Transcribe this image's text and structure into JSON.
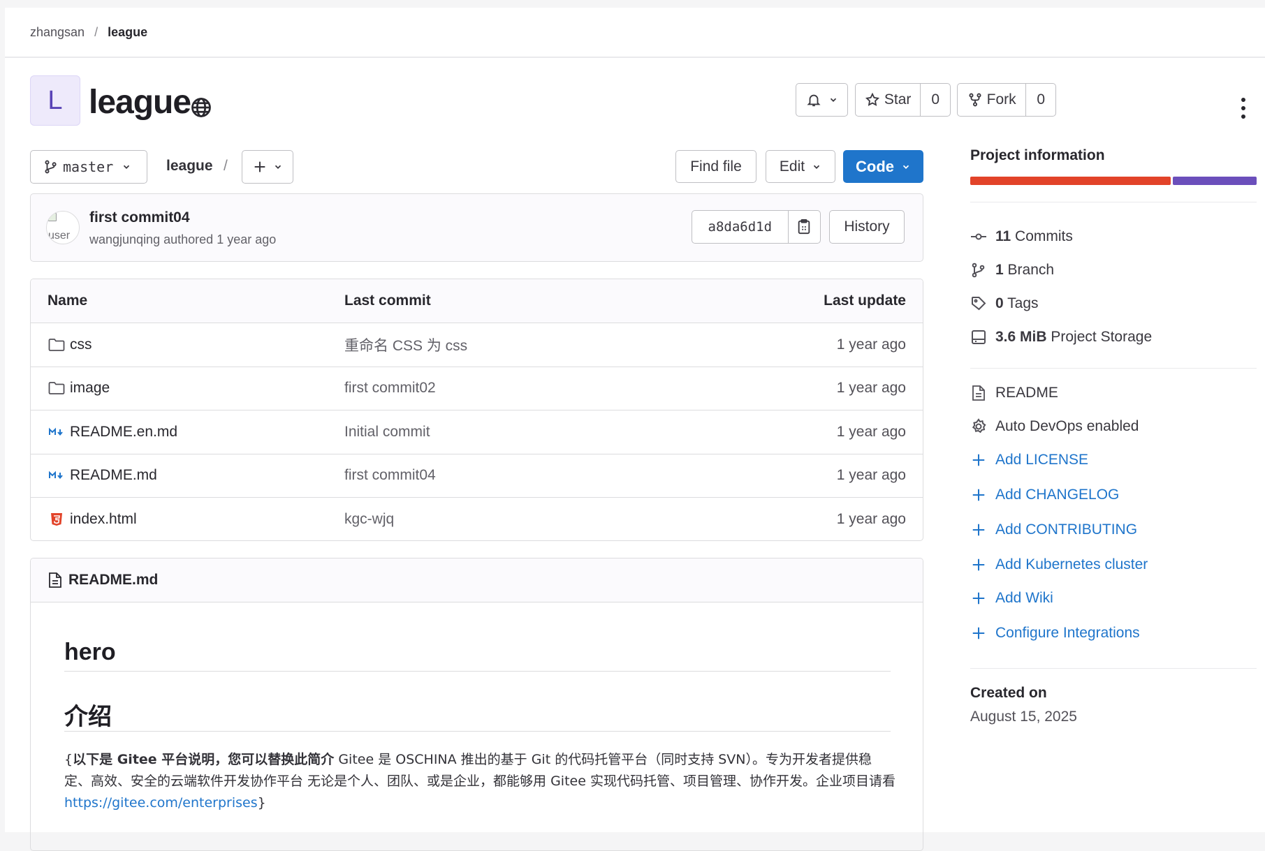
{
  "breadcrumb": {
    "owner": "zhangsan",
    "separator": "/",
    "project": "league"
  },
  "header": {
    "avatar_letter": "L",
    "title": "league",
    "star_label": "Star",
    "star_count": "0",
    "fork_label": "Fork",
    "fork_count": "0"
  },
  "repo_nav": {
    "branch": "master",
    "path_root": "league",
    "path_sep": "/",
    "find_file": "Find file",
    "edit": "Edit",
    "code": "Code"
  },
  "last_commit": {
    "avatar_alt": "user",
    "title": "first commit04",
    "author": "wangjunqing",
    "authored_text": "authored",
    "time": "1 year ago",
    "sha": "a8da6d1d",
    "history": "History"
  },
  "files": {
    "headers": {
      "name": "Name",
      "last_commit": "Last commit",
      "last_update": "Last update"
    },
    "rows": [
      {
        "name": "css",
        "type": "folder",
        "commit": "重命名 CSS 为 css",
        "updated": "1 year ago"
      },
      {
        "name": "image",
        "type": "folder",
        "commit": "first commit02",
        "updated": "1 year ago"
      },
      {
        "name": "README.en.md",
        "type": "markdown",
        "commit": "Initial commit",
        "updated": "1 year ago"
      },
      {
        "name": "README.md",
        "type": "markdown",
        "commit": "first commit04",
        "updated": "1 year ago"
      },
      {
        "name": "index.html",
        "type": "html",
        "commit": "kgc-wjq",
        "updated": "1 year ago"
      }
    ]
  },
  "readme": {
    "filename": "README.md",
    "h1": "hero",
    "h2": "介绍",
    "p_open": "{",
    "p_bold": "以下是 Gitee 平台说明，您可以替换此简介",
    "p_text": " Gitee 是 OSCHINA 推出的基于 Git 的代码托管平台（同时支持 SVN）。专为开发者提供稳定、高效、安全的云端软件开发协作平台 无论是个人、团队、或是企业，都能够用 Gitee 实现代码托管、项目管理、协作开发。企业项目请看 ",
    "p_link": "https://gitee.com/enterprises",
    "p_close": "}"
  },
  "sidebar": {
    "title": "Project information",
    "languages": [
      {
        "color": "#e24329",
        "share": 0.705
      },
      {
        "color": "#6b4fbb",
        "share": 0.295
      }
    ],
    "stats": [
      {
        "count": "11",
        "label": "Commits",
        "icon": "commit-icon"
      },
      {
        "count": "1",
        "label": "Branch",
        "icon": "branch-icon"
      },
      {
        "count": "0",
        "label": "Tags",
        "icon": "tag-icon"
      },
      {
        "count": "3.6 MiB",
        "label": "Project Storage",
        "icon": "storage-icon"
      }
    ],
    "files": [
      {
        "label": "README",
        "icon": "document-icon"
      },
      {
        "label": "Auto DevOps enabled",
        "icon": "gear-icon"
      }
    ],
    "actions": [
      "Add LICENSE",
      "Add CHANGELOG",
      "Add CONTRIBUTING",
      "Add Kubernetes cluster",
      "Add Wiki",
      "Configure Integrations"
    ],
    "created_label": "Created on",
    "created_date": "August 15, 2025"
  },
  "colors": {
    "primary": "#1f75cb",
    "link": "#1f75cb"
  }
}
